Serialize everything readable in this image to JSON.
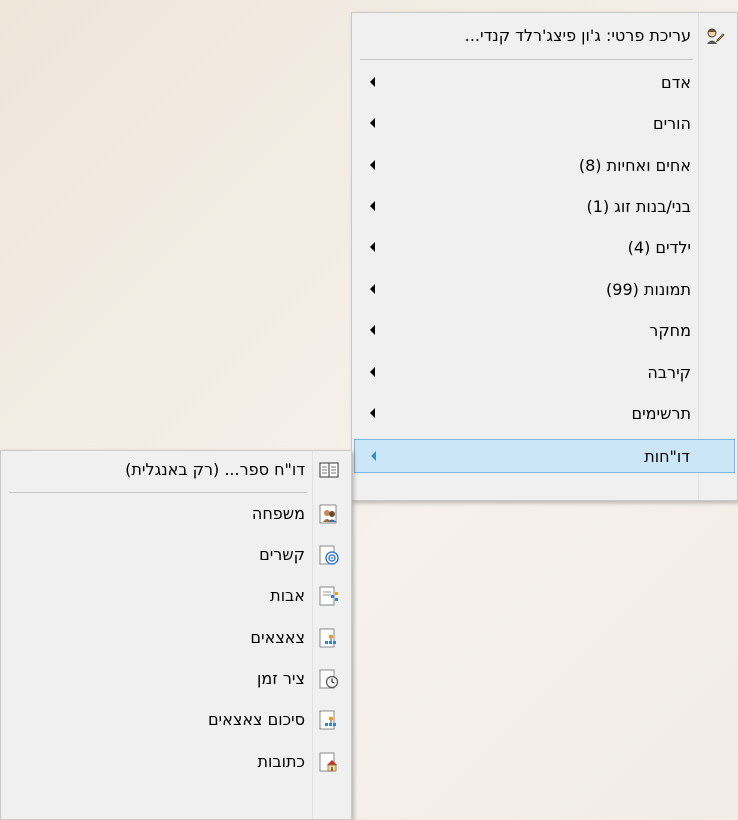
{
  "main_menu": {
    "header": {
      "label": "עריכת פרטי: ג'ון פיצג'רלד קנדי...",
      "icon": "person-edit-icon"
    },
    "items": [
      {
        "label": "אדם"
      },
      {
        "label": "הורים"
      },
      {
        "label": "אחים ואחיות (8)"
      },
      {
        "label": "בני/בנות זוג (1)"
      },
      {
        "label": "ילדים (4)"
      },
      {
        "label": "תמונות (99)"
      },
      {
        "label": "מחקר"
      },
      {
        "label": "קירבה"
      },
      {
        "label": "תרשימים"
      },
      {
        "label": "דו\"חות"
      }
    ]
  },
  "sub_menu": {
    "header": {
      "label": "דו\"ח ספר... (רק באנגלית)",
      "icon": "book-icon"
    },
    "items": [
      {
        "label": "משפחה",
        "icon": "family-report-icon"
      },
      {
        "label": "קשרים",
        "icon": "relationship-report-icon"
      },
      {
        "label": "אבות",
        "icon": "ancestors-report-icon"
      },
      {
        "label": "צאצאים",
        "icon": "descendants-report-icon"
      },
      {
        "label": "ציר זמן",
        "icon": "timeline-report-icon"
      },
      {
        "label": "סיכום צאצאים",
        "icon": "descendants-summary-icon"
      },
      {
        "label": "כתובות",
        "icon": "addresses-report-icon"
      }
    ]
  },
  "colors": {
    "menu_bg": "#f0f0f0",
    "highlight_bg": "#cde6f7",
    "highlight_border": "#7fb6e3",
    "separator": "#c5c5c5"
  }
}
